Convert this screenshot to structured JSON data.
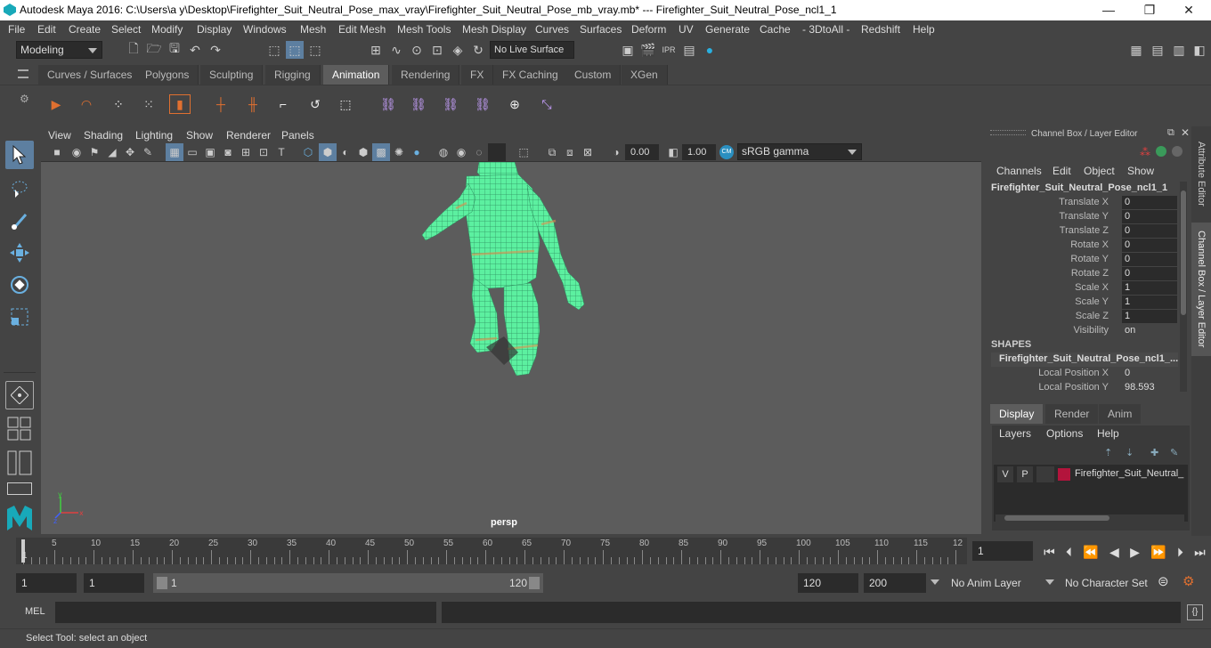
{
  "window": {
    "title": "Autodesk Maya 2016: C:\\Users\\a y\\Desktop\\Firefighter_Suit_Neutral_Pose_max_vray\\Firefighter_Suit_Neutral_Pose_mb_vray.mb*   ---   Firefighter_Suit_Neutral_Pose_ncl1_1",
    "minimize": "—",
    "maximize": "❐",
    "close": "✕"
  },
  "menubar": [
    "File",
    "Edit",
    "Create",
    "Select",
    "Modify",
    "Display",
    "Windows",
    "Mesh",
    "Edit Mesh",
    "Mesh Tools",
    "Mesh Display",
    "Curves",
    "Surfaces",
    "Deform",
    "UV",
    "Generate",
    "Cache",
    "- 3DtoAll -",
    "Redshift",
    "Help"
  ],
  "statusline": {
    "mode": "Modeling",
    "live_surface": "No Live Surface"
  },
  "shelf_tabs": [
    "Curves / Surfaces",
    "Polygons",
    "Sculpting",
    "Rigging",
    "Animation",
    "Rendering",
    "FX",
    "FX Caching",
    "Custom",
    "XGen"
  ],
  "active_shelf_tab": "Animation",
  "panel_menu": [
    "View",
    "Shading",
    "Lighting",
    "Show",
    "Renderer",
    "Panels"
  ],
  "panel_toolbar": {
    "exposure": "0.00",
    "gamma": "1.00",
    "colorspace": "sRGB gamma"
  },
  "viewport": {
    "camera_label": "persp",
    "mesh_color": "#5cf0a0"
  },
  "channel_box": {
    "header": "Channel Box / Layer Editor",
    "menu": [
      "Channels",
      "Edit",
      "Object",
      "Show"
    ],
    "object_name": "Firefighter_Suit_Neutral_Pose_ncl1_1",
    "attributes": [
      {
        "label": "Translate X",
        "value": "0"
      },
      {
        "label": "Translate Y",
        "value": "0"
      },
      {
        "label": "Translate Z",
        "value": "0"
      },
      {
        "label": "Rotate X",
        "value": "0"
      },
      {
        "label": "Rotate Y",
        "value": "0"
      },
      {
        "label": "Rotate Z",
        "value": "0"
      },
      {
        "label": "Scale X",
        "value": "1"
      },
      {
        "label": "Scale Y",
        "value": "1"
      },
      {
        "label": "Scale Z",
        "value": "1"
      },
      {
        "label": "Visibility",
        "value": "on"
      }
    ],
    "shapes_heading": "SHAPES",
    "shape_name": "Firefighter_Suit_Neutral_Pose_ncl1_...",
    "shape_attributes": [
      {
        "label": "Local Position X",
        "value": "0"
      },
      {
        "label": "Local Position Y",
        "value": "98.593"
      }
    ]
  },
  "side_tabs": [
    "Attribute Editor",
    "Channel Box / Layer Editor"
  ],
  "layer_editor": {
    "tabs": [
      "Display",
      "Render",
      "Anim"
    ],
    "active_tab": "Display",
    "menu": [
      "Layers",
      "Options",
      "Help"
    ],
    "layer": {
      "v": "V",
      "p": "P",
      "name": "Firefighter_Suit_Neutral_",
      "color": "#b3143c"
    }
  },
  "timeline": {
    "ticks": [
      "5",
      "10",
      "15",
      "20",
      "25",
      "30",
      "35",
      "40",
      "45",
      "50",
      "55",
      "60",
      "65",
      "70",
      "75",
      "80",
      "85",
      "90",
      "95",
      "100",
      "105",
      "110",
      "115",
      "12"
    ],
    "start_marker": "1",
    "current_frame": "1"
  },
  "range": {
    "start": "1",
    "playback_start": "1",
    "slider_start": "1",
    "slider_end": "120",
    "playback_end": "120",
    "end": "200",
    "anim_layer": "No Anim Layer",
    "character_set": "No Character Set"
  },
  "command_line": {
    "label": "MEL"
  },
  "help_line": "Select Tool: select an object"
}
